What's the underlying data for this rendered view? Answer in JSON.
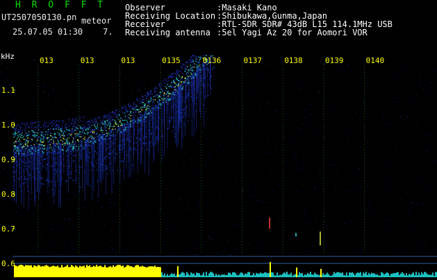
{
  "header": {
    "brand": "H R O F F T",
    "file_name": "UT2507050130.pn",
    "tag": "meteor",
    "date": "25.07.05",
    "time": "01:30",
    "count": "7.",
    "fields": [
      {
        "key": "Observer",
        "value": ":Masaki Kano"
      },
      {
        "key": "Receiving Location",
        "value": ":Shibukawa,Gunma,Japan"
      },
      {
        "key": "Receiver",
        "value": ":RTL-SDR SDR# 43dB L15 114.1MHz USB"
      },
      {
        "key": "Receiving antenna",
        "value": ":5el Yagi Az 20 for Aomori VOR"
      }
    ]
  },
  "spectrogram": {
    "y_unit": "kHz",
    "y_ticks": [
      "1.1",
      "1.0",
      "0.9",
      "0.8",
      "0.7",
      "0.6"
    ],
    "x_ticks": [
      "013",
      "013",
      "013",
      "0135",
      "0136",
      "0137",
      "0138",
      "0139",
      "0140"
    ],
    "colors": {
      "background": "#000000",
      "grid": "#40c040",
      "signal_low": "#1a2aa0",
      "signal_mid": "#20c8c8",
      "signal_high": "#e0f040",
      "label_yellow": "#ffff00",
      "bar_yellow": "#ffff00",
      "bar_cyan": "#20e0e0"
    }
  }
}
